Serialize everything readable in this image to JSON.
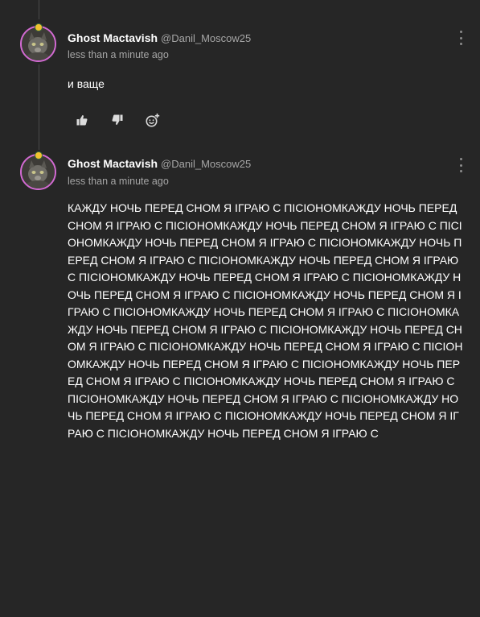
{
  "comments": [
    {
      "author_name": "Ghost Mactavish",
      "author_handle": "@Danil_Moscow25",
      "timestamp": "less than a minute ago",
      "body": "и ваще",
      "actions": [
        "thumbs-up-icon",
        "thumbs-down-icon",
        "add-reaction-icon"
      ]
    },
    {
      "author_name": "Ghost Mactavish",
      "author_handle": "@Danil_Moscow25",
      "timestamp": "less than a minute ago",
      "body": "КАЖДУ НОЧЬ ПЕРЕД СНОМ Я ІГРАЮ С ПІСІОНОМКАЖДУ НОЧЬ ПЕРЕД СНОМ Я ІГРАЮ С ПІСІОНОМКАЖДУ НОЧЬ ПЕРЕД СНОМ Я ІГРАЮ С ПІСІОНОМКАЖДУ НОЧЬ ПЕРЕД СНОМ Я ІГРАЮ С ПІСІОНОМКАЖДУ НОЧЬ ПЕРЕД СНОМ Я ІГРАЮ С ПІСІОНОМКАЖДУ НОЧЬ ПЕРЕД СНОМ Я ІГРАЮ С ПІСІОНОМКАЖДУ НОЧЬ ПЕРЕД СНОМ Я ІГРАЮ С ПІСІОНОМКАЖДУ НОЧЬ ПЕРЕД СНОМ Я ІГРАЮ С ПІСІОНОМКАЖДУ НОЧЬ ПЕРЕД СНОМ Я ІГРАЮ С ПІСІОНОМКАЖДУ НОЧЬ ПЕРЕД СНОМ Я ІГРАЮ С ПІСІОНОМКАЖДУ НОЧЬ ПЕРЕД СНОМ Я ІГРАЮ С ПІСІОНОМКАЖДУ НОЧЬ ПЕРЕД СНОМ Я ІГРАЮ С ПІСІОНОМКАЖДУ НОЧЬ ПЕРЕД СНОМ Я ІГРАЮ С ПІСІОНОМКАЖДУ НОЧЬ ПЕРЕД СНОМ Я ІГРАЮ С ПІСІОНОМКАЖДУ НОЧЬ ПЕРЕД СНОМ Я ІГРАЮ С ПІСІОНОМКАЖДУ НОЧЬ ПЕРЕД СНОМ Я ІГРАЮ С ПІСІОНОМКАЖДУ НОЧЬ ПЕРЕД СНОМ Я ІГРАЮ С ПІСІОНОМКАЖДУ НОЧЬ ПЕРЕД СНОМ Я ІГРАЮ С ПІСІОНОМКАЖДУ НОЧЬ ПЕРЕД СНОМ Я ІГРАЮ С ПІСІОНОМКАЖДУ НОЧЬ ПЕРЕД СНОМ Я ІГРАЮ С"
    }
  ],
  "colors": {
    "background": "#262626",
    "text": "#ffffff",
    "muted": "#a6a6a6",
    "avatar_ring": "#d26ad2",
    "badge": "#f2c230"
  }
}
